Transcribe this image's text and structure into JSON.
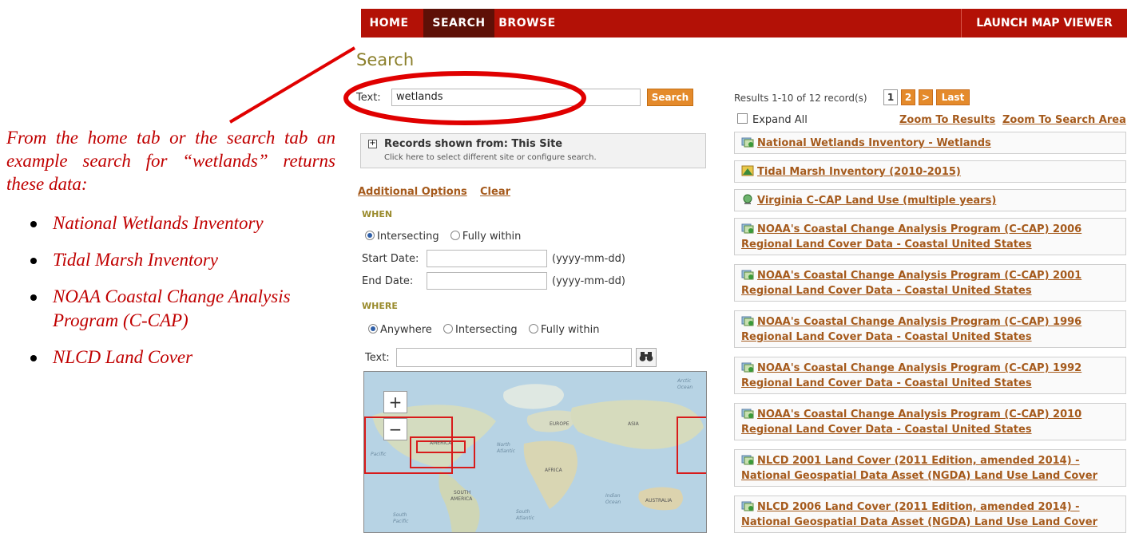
{
  "nav": {
    "tabs": [
      "HOME",
      "SEARCH",
      "BROWSE"
    ],
    "active": "SEARCH",
    "launch": "LAUNCH MAP VIEWER"
  },
  "page": {
    "title": "Search"
  },
  "search": {
    "text_label": "Text:",
    "text_value": "wetlands",
    "button": "Search"
  },
  "records": {
    "title": "Records shown from: This Site",
    "subtitle": "Click here to select different site or configure search."
  },
  "options": {
    "additional": "Additional Options",
    "clear": "Clear"
  },
  "when": {
    "heading": "WHEN",
    "intersecting": "Intersecting",
    "fully_within": "Fully within",
    "start_label": "Start Date:",
    "end_label": "End Date:",
    "date_hint": "(yyyy-mm-dd)"
  },
  "where": {
    "heading": "WHERE",
    "anywhere": "Anywhere",
    "intersecting": "Intersecting",
    "fully_within": "Fully within",
    "text_label": "Text:"
  },
  "map": {
    "zoom_in": "+",
    "zoom_out": "−",
    "labels": {
      "arctic": "Arctic",
      "ocean1": "Ocean",
      "america": "AMERICA",
      "europe": "EUROPE",
      "asia": "ASIA",
      "north": "North",
      "atlantic": "Atlantic",
      "pacific": "Pacific",
      "africa": "AFRICA",
      "south_am": "SOUTH",
      "america2": "AMERICA",
      "indian": "Indian",
      "ocean2": "Ocean",
      "australia": "AUSTRALIA",
      "south_pacific": "South",
      "pacific2": "Pacific",
      "south_atl": "South",
      "atlantic2": "Atlantic"
    }
  },
  "results": {
    "count": "Results 1-10 of 12 record(s)",
    "pages": [
      "1",
      "2",
      ">",
      "Last"
    ],
    "expand_all": "Expand All",
    "zoom_results": "Zoom To Results",
    "zoom_area": "Zoom To Search Area",
    "items": [
      {
        "line1": "National Wetlands Inventory - Wetlands",
        "line2": "",
        "icon": "map-layer-icon"
      },
      {
        "line1": "Tidal Marsh Inventory (2010-2015)",
        "line2": "",
        "icon": "raster-icon"
      },
      {
        "line1": "Virginia C-CAP Land Use (multiple years)",
        "line2": "",
        "icon": "globe-icon"
      },
      {
        "line1": "NOAA's Coastal Change Analysis Program (C-CAP) 2006",
        "line2": "Regional Land Cover Data - Coastal United States",
        "icon": "map-layer-icon"
      },
      {
        "line1": "NOAA's Coastal Change Analysis Program (C-CAP) 2001",
        "line2": "Regional Land Cover Data - Coastal United States",
        "icon": "map-layer-icon"
      },
      {
        "line1": "NOAA's Coastal Change Analysis Program (C-CAP) 1996",
        "line2": "Regional Land Cover Data - Coastal United States",
        "icon": "map-layer-icon"
      },
      {
        "line1": "NOAA's Coastal Change Analysis Program (C-CAP) 1992",
        "line2": "Regional Land Cover Data - Coastal United States",
        "icon": "map-layer-icon"
      },
      {
        "line1": "NOAA's Coastal Change Analysis Program (C-CAP) 2010",
        "line2": "Regional Land Cover Data - Coastal United States",
        "icon": "map-layer-icon"
      },
      {
        "line1": "NLCD 2001 Land Cover (2011 Edition, amended 2014) -",
        "line2": "National Geospatial Data Asset (NGDA) Land Use Land Cover",
        "icon": "map-layer-icon"
      },
      {
        "line1": "NLCD 2006 Land Cover (2011 Edition, amended 2014) -",
        "line2": "National Geospatial Data Asset (NGDA) Land Use Land Cover",
        "icon": "map-layer-icon"
      }
    ]
  },
  "annotation": {
    "paragraph": "From the home tab or the search tab an example search for “wetlands” returns these data:",
    "bullets": [
      "National Wetlands Inventory",
      "Tidal Marsh Inventory",
      "NOAA Coastal Change Analysis Program (C-CAP)",
      "NLCD Land Cover"
    ]
  },
  "colors": {
    "nav_red": "#b31106",
    "nav_active": "#5e1007",
    "accent_orange": "#e48a2b",
    "link_brown": "#a55a1c",
    "annotation_red": "#c00000"
  }
}
